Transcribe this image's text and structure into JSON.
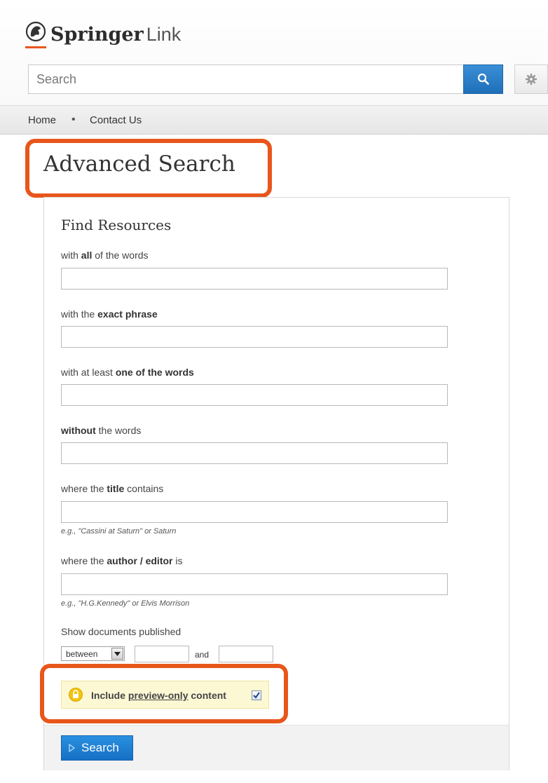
{
  "header": {
    "logo_brand": "Springer",
    "logo_suffix": "Link",
    "search_placeholder": "Search",
    "search_button_icon": "search-icon",
    "settings_icon": "gear-icon",
    "brand_color": "#e8561b",
    "accent_color": "#1f6fb9"
  },
  "nav": {
    "items": [
      "Home",
      "Contact Us"
    ],
    "separator": "•"
  },
  "page": {
    "title": "Advanced Search"
  },
  "form": {
    "section_title": "Find Resources",
    "fields": [
      {
        "prefix": "with ",
        "bold": "all",
        "suffix": " of the words",
        "value": ""
      },
      {
        "prefix": "with the ",
        "bold": "exact phrase",
        "suffix": "",
        "value": ""
      },
      {
        "prefix": "with at least ",
        "bold": "one of the words",
        "suffix": "",
        "value": ""
      },
      {
        "prefix": "",
        "bold": "without",
        "suffix": " the words",
        "value": ""
      },
      {
        "prefix": "where the ",
        "bold": "title",
        "suffix": " contains",
        "value": "",
        "hint": "e.g., \"Cassini at Saturn\" or Saturn"
      },
      {
        "prefix": "where the ",
        "bold": "author / editor",
        "suffix": " is",
        "value": "",
        "hint": "e.g., \"H.G.Kennedy\" or Elvis Morrison"
      }
    ],
    "date_label": "Show documents published",
    "date_mode": "between",
    "date_and": "and",
    "date_from": "",
    "date_to": "",
    "preview": {
      "prefix": "Include ",
      "link": "preview-only",
      "suffix": " content",
      "checked": true
    },
    "submit_label": "Search"
  }
}
